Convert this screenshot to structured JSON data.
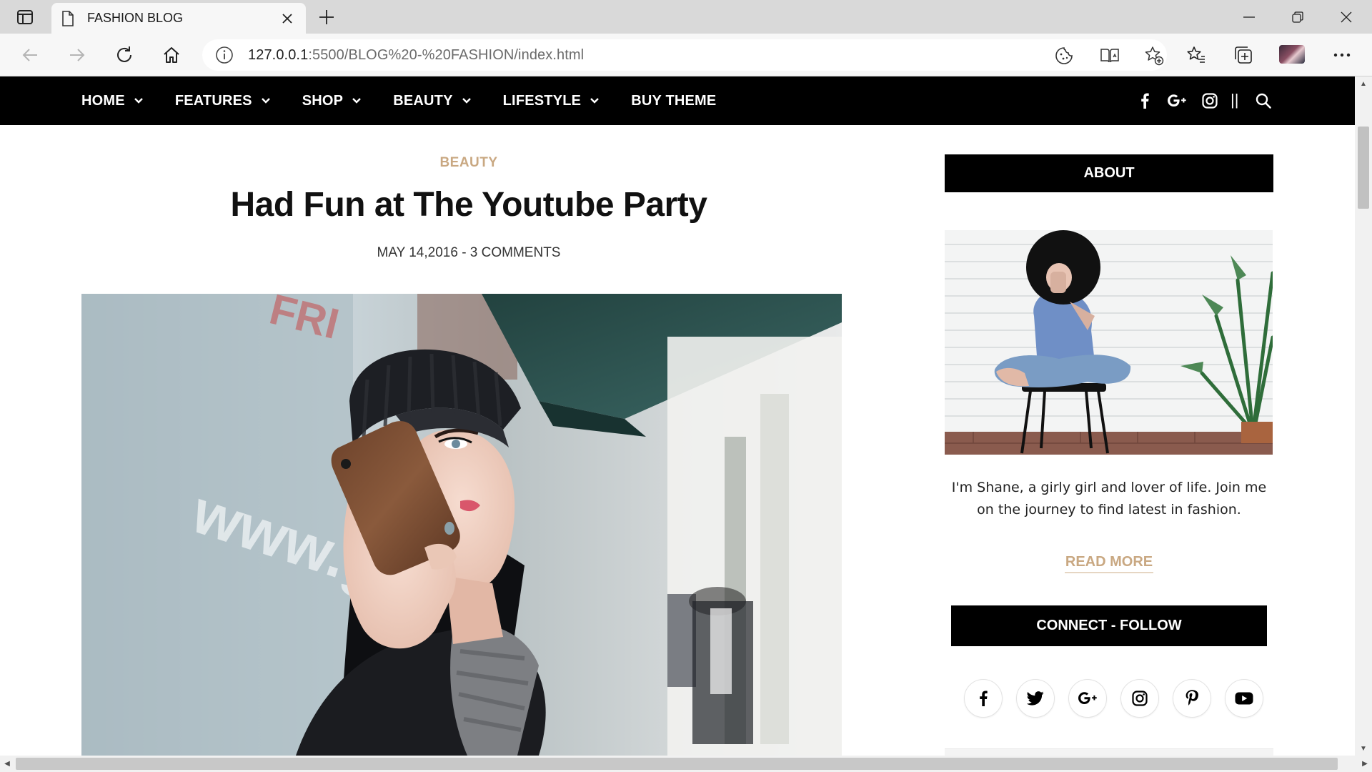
{
  "browser": {
    "tab_title": "FASHION BLOG",
    "url_host": "127.0.0.1",
    "url_path": ":5500/BLOG%20-%20FASHION/index.html",
    "icons": [
      "tab-actions-icon",
      "page-icon",
      "close-icon",
      "plus-icon",
      "minimize-icon",
      "restore-icon",
      "window-close-icon",
      "back-arrow-icon",
      "forward-arrow-icon",
      "refresh-icon",
      "home-icon",
      "info-icon",
      "cookie-icon",
      "immersive-reader-icon",
      "add-favorite-icon",
      "favorites-icon",
      "collections-icon",
      "profile-avatar",
      "more-icon"
    ]
  },
  "site_nav": {
    "items": [
      {
        "label": "HOME",
        "has_dropdown": true
      },
      {
        "label": "FEATURES",
        "has_dropdown": true
      },
      {
        "label": "SHOP",
        "has_dropdown": true
      },
      {
        "label": "BEAUTY",
        "has_dropdown": true
      },
      {
        "label": "LIFESTYLE",
        "has_dropdown": true
      },
      {
        "label": "BUY THEME",
        "has_dropdown": false
      }
    ],
    "separator": "||",
    "social_icons": [
      "facebook-icon",
      "google-plus-icon",
      "instagram-icon",
      "search-icon"
    ]
  },
  "post": {
    "category": "BEAUTY",
    "title": "Had Fun at The Youtube Party",
    "meta": "MAY 14,2016 - 3 COMMENTS"
  },
  "sidebar": {
    "about_title": "ABOUT",
    "about_text": "I'm Shane, a girly girl and lover of life. Join me on the journey to find latest in fashion.",
    "read_more": "READ MORE",
    "connect_title": "CONNECT - FOLLOW",
    "social": [
      "facebook-icon",
      "twitter-icon",
      "google-plus-icon",
      "instagram-icon",
      "pinterest-icon",
      "youtube-icon"
    ]
  },
  "colors": {
    "accent": "#c9a882",
    "nav_bg": "#000000",
    "chrome_bg": "#d9d9d9",
    "toolbar_bg": "#f7f7f7"
  }
}
